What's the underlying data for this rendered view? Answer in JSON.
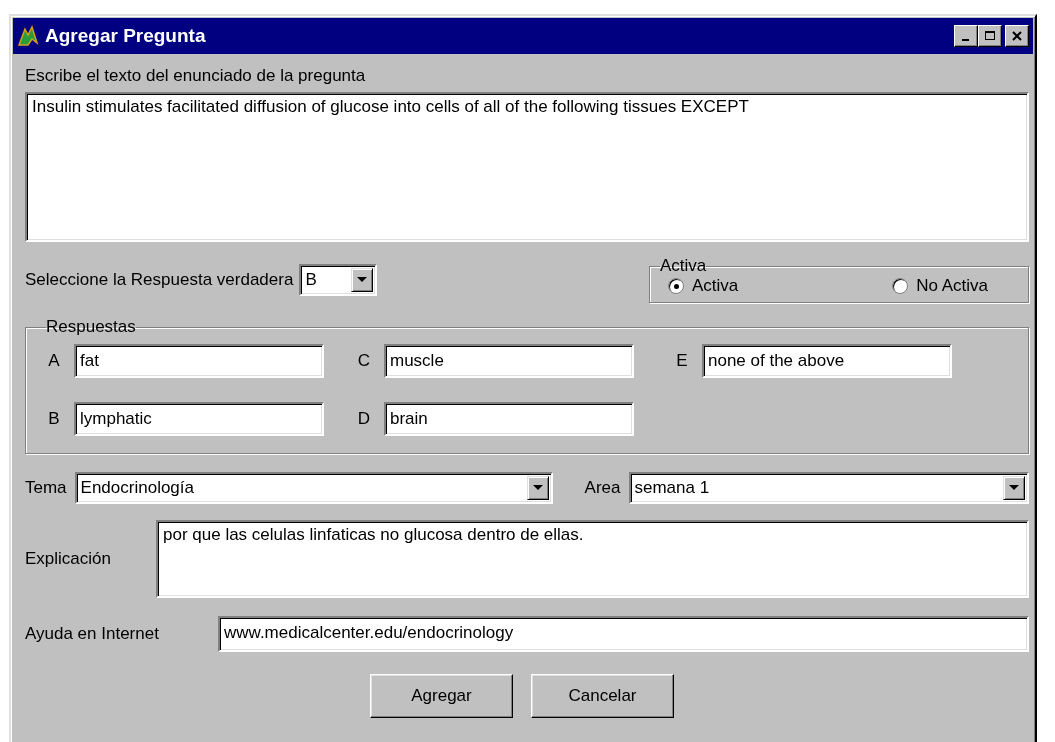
{
  "window": {
    "title": "Agregar Pregunta"
  },
  "prompt": {
    "label": "Escribe el texto del enunciado de la pregunta",
    "value": "Insulin stimulates facilitated diffusion of glucose into cells of all of the following tissues EXCEPT"
  },
  "correct_answer": {
    "label": "Seleccione la Respuesta verdadera",
    "value": "B"
  },
  "status_group": {
    "title": "Activa",
    "options": [
      {
        "label": "Activa",
        "selected": true
      },
      {
        "label": "No Activa",
        "selected": false
      }
    ]
  },
  "answers_group": {
    "title": "Respuestas",
    "answers": [
      {
        "letter": "A",
        "value": "fat"
      },
      {
        "letter": "B",
        "value": "lymphatic"
      },
      {
        "letter": "C",
        "value": "muscle"
      },
      {
        "letter": "D",
        "value": "brain"
      },
      {
        "letter": "E",
        "value": "none of the above"
      }
    ]
  },
  "tema": {
    "label": "Tema",
    "value": "Endocrinología"
  },
  "area": {
    "label": "Area",
    "value": "semana 1"
  },
  "explanation": {
    "label": "Explicación",
    "value": "por que las celulas linfaticas no glucosa dentro de ellas."
  },
  "help": {
    "label": "Ayuda en Internet",
    "value": "www.medicalcenter.edu/endocrinology"
  },
  "buttons": [
    "Agregar",
    "Cancelar"
  ]
}
